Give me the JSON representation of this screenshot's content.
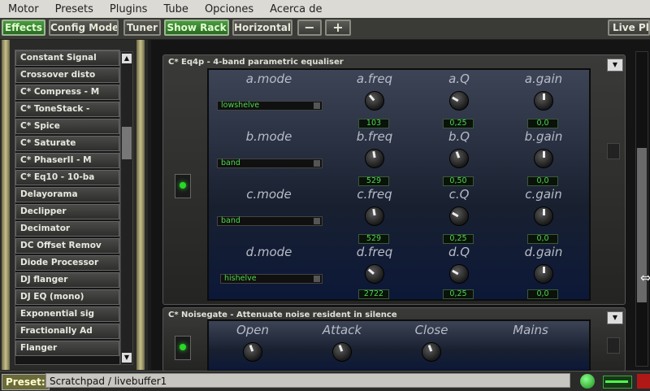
{
  "menubar": [
    "Motor",
    "Presets",
    "Plugins",
    "Tube",
    "Opciones",
    "Acerca de"
  ],
  "toolbar": {
    "effects": "Effects",
    "config_mode": "Config Mode",
    "tuner": "Tuner",
    "show_rack": "Show Rack",
    "horizontal": "Horizontal",
    "minus": "−",
    "plus": "+",
    "live_play": "Live Pla"
  },
  "plugins": [
    "Constant Signal",
    "Crossover disto",
    "C* Compress - M",
    "C* ToneStack -",
    "C* Spice",
    "C* Saturate",
    "C* PhaserII - M",
    "C* Eq10 - 10-ba",
    "Delayorama",
    "Declipper",
    "Decimator",
    "DC Offset Remov",
    "Diode Processor",
    "DJ flanger",
    "DJ EQ (mono)",
    "Exponential sig",
    "Fractionally Ad",
    "Flanger"
  ],
  "eq4p": {
    "title": "C* Eq4p - 4-band parametric equaliser",
    "rows": [
      {
        "mode_label": "a.mode",
        "mode": "lowshelve",
        "freq_label": "a.freq",
        "freq": "103",
        "q_label": "a.Q",
        "q": "0,25",
        "gain_label": "a.gain",
        "gain": "0,0"
      },
      {
        "mode_label": "b.mode",
        "mode": "band",
        "freq_label": "b.freq",
        "freq": "529",
        "q_label": "b.Q",
        "q": "0,50",
        "gain_label": "b.gain",
        "gain": "0,0"
      },
      {
        "mode_label": "c.mode",
        "mode": "band",
        "freq_label": "c.freq",
        "freq": "529",
        "q_label": "c.Q",
        "q": "0,25",
        "gain_label": "c.gain",
        "gain": "0,0"
      },
      {
        "mode_label": "d.mode",
        "mode": "hishelve",
        "freq_label": "d.freq",
        "freq": "2722",
        "q_label": "d.Q",
        "q": "0,25",
        "gain_label": "d.gain",
        "gain": "0,0"
      }
    ]
  },
  "noisegate": {
    "title": "C* Noisegate - Attenuate noise resident in silence",
    "labels": [
      "Open",
      "Attack",
      "Close",
      "Mains"
    ]
  },
  "status": {
    "preset_label": "Preset:",
    "preset_value": "Scratchpad / livebuffer1"
  },
  "colors": {
    "accent_green": "#4cd84c",
    "panel_blue": "#0c1838",
    "active_button": "#2a6a22"
  }
}
